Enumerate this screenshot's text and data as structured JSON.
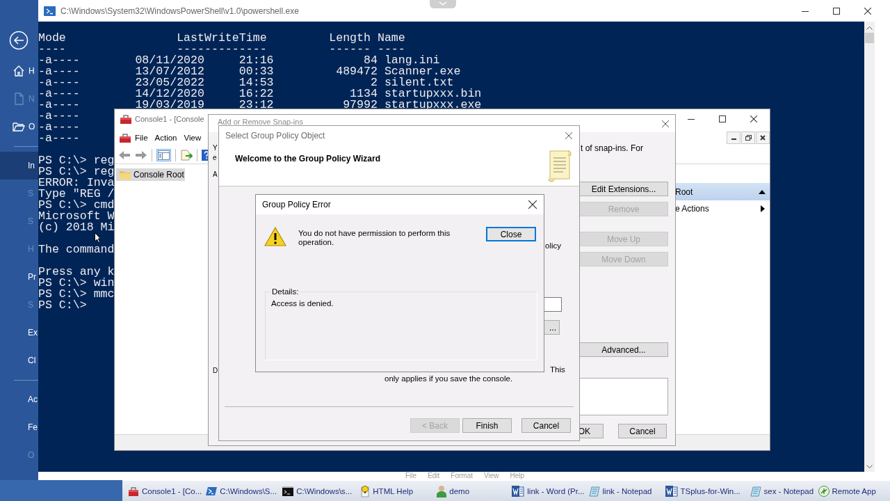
{
  "backstage": {
    "items": [
      {
        "kind": "home",
        "label": "H",
        "selected": false,
        "faded": false
      },
      {
        "kind": "new",
        "label": "N",
        "selected": false,
        "faded": true
      },
      {
        "kind": "open",
        "label": "O",
        "selected": false,
        "faded": false
      },
      {
        "kind": "divider"
      },
      {
        "kind": "text",
        "label": "In",
        "selected": true,
        "faded": false
      },
      {
        "kind": "text",
        "label": "S",
        "selected": false,
        "faded": true
      },
      {
        "kind": "text",
        "label": "S",
        "selected": false,
        "faded": true
      },
      {
        "kind": "text",
        "label": "H",
        "selected": false,
        "faded": true
      },
      {
        "kind": "text",
        "label": "Pr",
        "selected": false,
        "faded": false
      },
      {
        "kind": "text",
        "label": "S",
        "selected": false,
        "faded": true
      },
      {
        "kind": "text",
        "label": "Ex",
        "selected": false,
        "faded": false
      },
      {
        "kind": "text",
        "label": "Cl",
        "selected": false,
        "faded": false
      },
      {
        "kind": "divider"
      },
      {
        "kind": "text",
        "label": "Ac",
        "selected": false,
        "faded": false
      },
      {
        "kind": "text",
        "label": "Fe",
        "selected": false,
        "faded": false
      },
      {
        "kind": "text",
        "label": "O",
        "selected": false,
        "faded": true
      }
    ]
  },
  "powershell": {
    "title": "C:\\Windows\\System32\\WindowsPowerShell\\v1.0\\powershell.exe",
    "blocks": [
      [
        "Mode                LastWriteTime         Length Name",
        "----                -------------         ------ ----",
        "-a----        08/11/2020     21:16             84 lang.ini",
        "-a----        13/07/2012     00:33         489472 Scanner.exe",
        "-a----        23/05/2022     14:53              2 silent.txt",
        "-a----        14/12/2020     16:22           1134 startupxxx.bin",
        "-a----        19/03/2019     23:12          97992 startupxxx.exe",
        "-a----",
        "-a----",
        "-a----"
      ],
      [
        "PS C:\\> reg",
        "PS C:\\> reg",
        "ERROR: Inva",
        "Type \"REG /",
        "PS C:\\> cmd",
        "Microsoft W",
        "(c) 2018 Mi"
      ],
      [
        "The command"
      ],
      [
        "Press any k",
        "PS C:\\> win",
        "PS C:\\> mmc",
        "PS C:\\>"
      ]
    ]
  },
  "mmc": {
    "title": "Console1 - [Console",
    "menu": [
      "File",
      "Action",
      "View"
    ],
    "tree": [
      {
        "label": "Console Root",
        "selected": true
      }
    ],
    "actions": {
      "header": "Root",
      "items": [
        "e Actions"
      ]
    }
  },
  "snapins": {
    "title": "Add or Remove Snap-ins",
    "left_fragments": [
      "Y",
      "e",
      "A",
      "D"
    ],
    "intro_fragment": "t of snap-ins. For",
    "buttons": [
      {
        "label": "Edit Extensions...",
        "disabled": false
      },
      {
        "label": "Remove",
        "disabled": true
      },
      {
        "label": "Move Up",
        "disabled": true
      },
      {
        "label": "Move Down",
        "disabled": true
      },
      {
        "label": "Advanced...",
        "disabled": false
      }
    ],
    "footer_buttons": [
      "OK",
      "Cancel"
    ],
    "option_fragment": "olicy",
    "browse_button": "...",
    "description_fragments": [
      "This",
      "only applies if you save the console."
    ]
  },
  "wizard": {
    "title": "Select Group Policy Object",
    "heading": "Welcome to the Group Policy Wizard",
    "buttons": [
      {
        "label": "< Back",
        "disabled": true
      },
      {
        "label": "Finish",
        "disabled": false
      },
      {
        "label": "Cancel",
        "disabled": false
      }
    ]
  },
  "error_dialog": {
    "title": "Group Policy Error",
    "message": "You do not have permission to perform this operation.",
    "button": "Close",
    "details_label": "Details:",
    "details": "Access is denied."
  },
  "notepad_menu": [
    "File",
    "Edit",
    "Format",
    "View",
    "Help"
  ],
  "taskbar": {
    "items": [
      {
        "kind": "mmc",
        "label": "Console1 - [Co..."
      },
      {
        "kind": "powershell",
        "label": "C:\\Windows\\S..."
      },
      {
        "kind": "cmd",
        "label": "C:\\Windows\\s..."
      },
      {
        "kind": "help",
        "label": "HTML Help"
      },
      {
        "kind": "user",
        "label": "demo"
      },
      {
        "kind": "word",
        "label": "link - Word (Pr..."
      },
      {
        "kind": "notepad",
        "label": "link - Notepad"
      },
      {
        "kind": "word",
        "label": "TSplus-for-Win..."
      },
      {
        "kind": "notepad",
        "label": "sex - Notepad"
      },
      {
        "kind": "remote",
        "label": "Remote App"
      }
    ]
  }
}
